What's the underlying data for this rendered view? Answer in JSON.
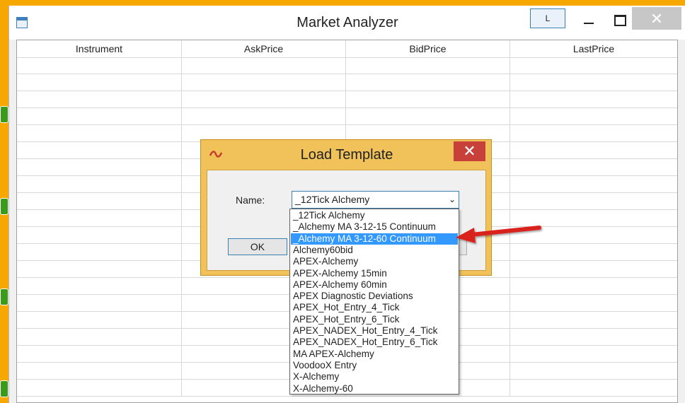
{
  "window": {
    "title": "Market Analyzer",
    "l_button": "L",
    "close_glyph": "✕"
  },
  "grid": {
    "columns": [
      "Instrument",
      "AskPrice",
      "BidPrice",
      "LastPrice"
    ]
  },
  "dialog": {
    "title": "Load Template",
    "close_glyph": "✕",
    "name_label": "Name:",
    "selected_value": "_12Tick Alchemy",
    "ok_label": "OK",
    "options": [
      "_12Tick Alchemy",
      "_Alchemy MA 3-12-15 Continuum",
      "_Alchemy MA 3-12-60 Continuum",
      "Alchemy60bid",
      "APEX-Alchemy",
      "APEX-Alchemy 15min",
      "APEX-Alchemy 60min",
      "APEX Diagnostic Deviations",
      "APEX_Hot_Entry_4_Tick",
      "APEX_Hot_Entry_6_Tick",
      "APEX_NADEX_Hot_Entry_4_Tick",
      "APEX_NADEX_Hot_Entry_6_Tick",
      "MA APEX-Alchemy",
      "VoodooX Entry",
      "X-Alchemy",
      "X-Alchemy-60"
    ],
    "highlighted_option": "_Alchemy MA 3-12-60 Continuum"
  },
  "colors": {
    "dialog_frame": "#f1c15a",
    "close_red": "#c7403a",
    "selection": "#3399ff",
    "arrow": "#d9221c"
  },
  "icons": [
    "app-window-icon",
    "minimize-icon",
    "maximize-icon",
    "close-icon",
    "dialog-logo-icon",
    "chevron-down-icon",
    "red-arrow-annotation"
  ]
}
